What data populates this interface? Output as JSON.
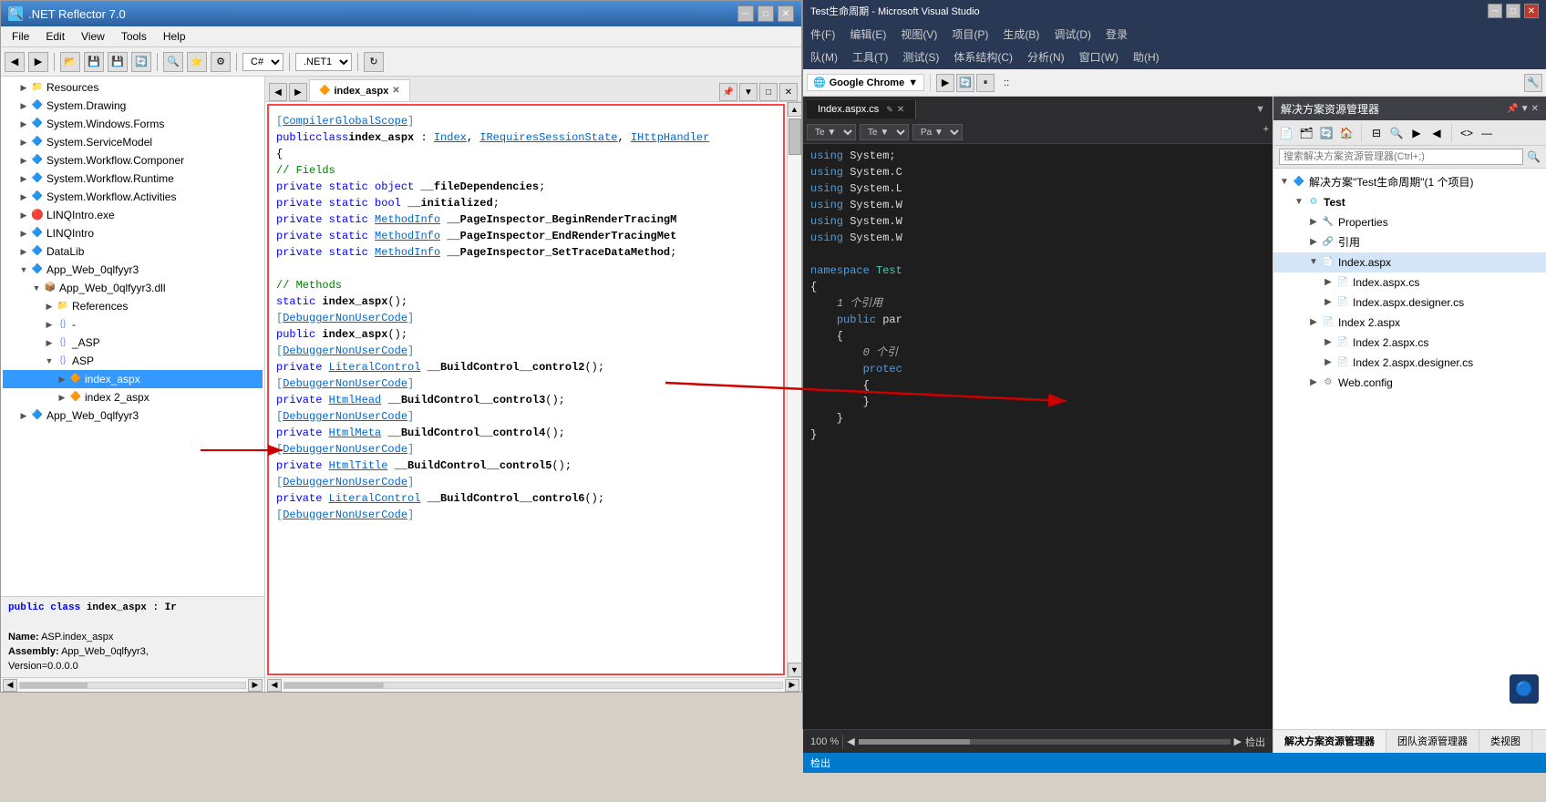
{
  "reflector": {
    "title": ".NET Reflector 7.0",
    "menu": [
      "File",
      "Edit",
      "View",
      "Tools",
      "Help"
    ],
    "lang_option": "C#",
    "net_option": ".NET",
    "tab_label": "index_aspx",
    "code": {
      "line1": "[CompilerGlobalScope]",
      "line2": "public class index_aspx : Index, IRequiresSessionState, IHttpHandler",
      "line3": "{",
      "line4": "    // Fields",
      "line5": "    private static object __fileDependencies;",
      "line6": "    private static bool __initialized;",
      "line7": "    private static MethodInfo __PageInspector_BeginRenderTracingM",
      "line8": "    private static MethodInfo __PageInspector_EndRenderTracingMet",
      "line9": "    private static MethodInfo __PageInspector_SetTraceDataMethod;",
      "line10": "",
      "line11": "    // Methods",
      "line12": "    static index_aspx();",
      "line13": "    [DebuggerNonUserCode]",
      "line14": "    public index_aspx();",
      "line15": "    [DebuggerNonUserCode]",
      "line16": "    private LiteralControl __BuildControl__control2();",
      "line17": "    [DebuggerNonUserCode]",
      "line18": "    private HtmlHead __BuildControl__control3();",
      "line19": "    [DebuggerNonUserCode]",
      "line20": "    private HtmlMeta __BuildControl__control4();",
      "line21": "    [DebuggerNonUserCode]",
      "line22": "    private HtmlTitle __BuildControl__control5();",
      "line23": "    [DebuggerNonUserCode]",
      "line24": "    private LiteralControl __BuildControl__control6();",
      "line25": "    [DebuggerNonUserCode]"
    }
  },
  "sidebar": {
    "items": [
      {
        "label": "Resources",
        "indent": 1,
        "type": "folder",
        "expanded": false
      },
      {
        "label": "System.Drawing",
        "indent": 1,
        "type": "namespace",
        "expanded": false
      },
      {
        "label": "System.Windows.Forms",
        "indent": 1,
        "type": "namespace",
        "expanded": false
      },
      {
        "label": "System.ServiceModel",
        "indent": 1,
        "type": "namespace",
        "expanded": false
      },
      {
        "label": "System.Workflow.Componer",
        "indent": 1,
        "type": "namespace",
        "expanded": false
      },
      {
        "label": "System.Workflow.Runtime",
        "indent": 1,
        "type": "namespace",
        "expanded": false
      },
      {
        "label": "System.Workflow.Activities",
        "indent": 1,
        "type": "namespace",
        "expanded": false
      },
      {
        "label": "LINQIntro.exe",
        "indent": 1,
        "type": "error",
        "expanded": false
      },
      {
        "label": "LINQIntro",
        "indent": 1,
        "type": "namespace",
        "expanded": false
      },
      {
        "label": "DataLib",
        "indent": 1,
        "type": "namespace",
        "expanded": false
      },
      {
        "label": "App_Web_0qlfyyr3",
        "indent": 1,
        "type": "namespace",
        "expanded": true
      },
      {
        "label": "App_Web_0qlfyyr3.dll",
        "indent": 2,
        "type": "dll",
        "expanded": true
      },
      {
        "label": "References",
        "indent": 3,
        "type": "folder",
        "expanded": false
      },
      {
        "label": "{} -",
        "indent": 3,
        "type": "namespace",
        "expanded": false
      },
      {
        "label": "{} _ASP",
        "indent": 3,
        "type": "namespace",
        "expanded": false
      },
      {
        "label": "{} ASP",
        "indent": 3,
        "type": "namespace",
        "expanded": true
      },
      {
        "label": "index_aspx",
        "indent": 4,
        "type": "class",
        "expanded": false,
        "selected": true
      },
      {
        "label": "index 2_aspx",
        "indent": 4,
        "type": "class",
        "expanded": false
      }
    ],
    "next_item": {
      "label": "App_Web_0qlfyyr3",
      "indent": 1,
      "type": "namespace"
    }
  },
  "status": {
    "class_label": "public class index_aspx : Ir",
    "name_label": "Name:",
    "name_value": "ASP.index_aspx",
    "assembly_label": "Assembly:",
    "assembly_value": "App_Web_0qlfyyr3,",
    "version_value": "Version=0.0.0.0"
  },
  "vs": {
    "title": "Test生命周期 - Microsoft Visual Studio",
    "menu": [
      "件(F)",
      "编辑(E)",
      "视图(V)",
      "项目(P)",
      "生成(B)",
      "调试(D)",
      "登录",
      "队(M)",
      "工具(T)",
      "测试(S)",
      "体系结构(C)",
      "分析(N)",
      "窗口(W)",
      "助(H)"
    ],
    "toolbar_label": "Google Chrome",
    "editor_tab": "Index.aspx.cs",
    "code": {
      "l1": "using System;",
      "l2": "using System.C",
      "l3": "using System.L",
      "l4": "using System.W",
      "l5": "using System.W",
      "l6": "using System.W",
      "l7": "",
      "l8": "namespace Test",
      "l9": "{",
      "l10": "    1 个引用",
      "l11": "    public par",
      "l12": "    {",
      "l13": "        0 个引",
      "l14": "        protec",
      "l15": "        {",
      "l16": "        }",
      "l17": "    }",
      "l18": "}"
    }
  },
  "solution_explorer": {
    "title": "解决方案资源管理器",
    "search_placeholder": "搜索解决方案资源管理器(Ctrl+;)",
    "solution_label": "解决方案\"Test生命周期\"(1 个项目)",
    "tree": [
      {
        "label": "Test",
        "indent": 1,
        "type": "project",
        "expanded": true
      },
      {
        "label": "Properties",
        "indent": 2,
        "type": "folder",
        "expanded": false
      },
      {
        "label": "引用",
        "indent": 2,
        "type": "ref",
        "expanded": false
      },
      {
        "label": "Index.aspx",
        "indent": 2,
        "type": "aspx",
        "expanded": true,
        "highlighted": true
      },
      {
        "label": "Index.aspx.cs",
        "indent": 3,
        "type": "cs",
        "expanded": false
      },
      {
        "label": "Index.aspx.designer.cs",
        "indent": 3,
        "type": "cs",
        "expanded": false
      },
      {
        "label": "Index 2.aspx",
        "indent": 2,
        "type": "aspx",
        "expanded": false
      },
      {
        "label": "Index 2.aspx.cs",
        "indent": 3,
        "type": "cs",
        "expanded": false
      },
      {
        "label": "Index 2.aspx.designer.cs",
        "indent": 3,
        "type": "cs",
        "expanded": false
      },
      {
        "label": "Web.config",
        "indent": 2,
        "type": "config",
        "expanded": false
      }
    ],
    "tabs": [
      "解决方案资源管理器",
      "团队资源管理器",
      "类视图"
    ]
  }
}
